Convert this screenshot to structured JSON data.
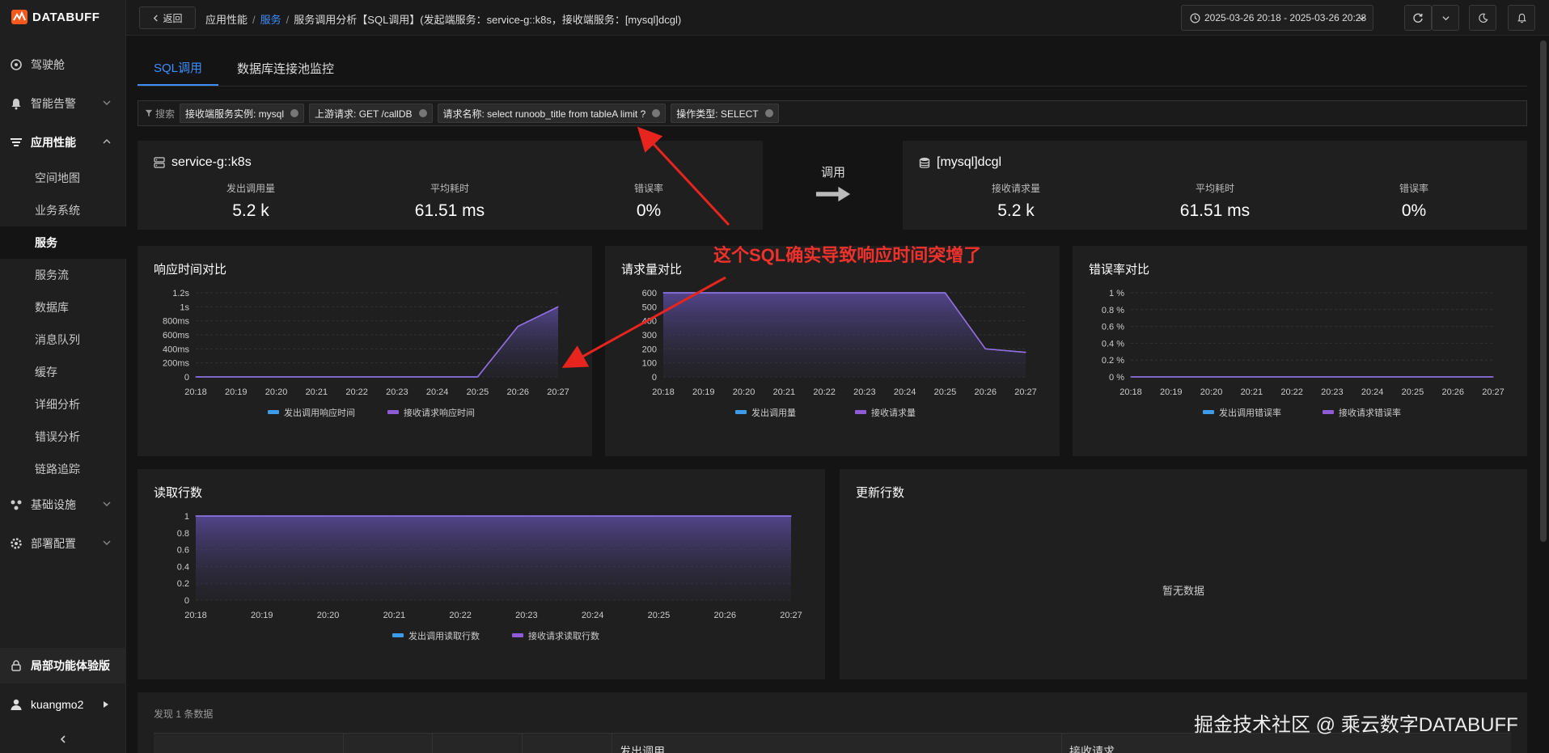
{
  "brand": {
    "name": "DATABUFF"
  },
  "sidebar": {
    "items": [
      {
        "label": "驾驶舱"
      },
      {
        "label": "智能告警"
      },
      {
        "label": "应用性能"
      },
      {
        "label": "基础设施"
      },
      {
        "label": "部署配置"
      }
    ],
    "sub_items": [
      {
        "label": "空间地图"
      },
      {
        "label": "业务系统"
      },
      {
        "label": "服务"
      },
      {
        "label": "服务流"
      },
      {
        "label": "数据库"
      },
      {
        "label": "消息队列"
      },
      {
        "label": "缓存"
      },
      {
        "label": "详细分析"
      },
      {
        "label": "错误分析"
      },
      {
        "label": "链路追踪"
      }
    ],
    "trial_label": "局部功能体验版",
    "user_name": "kuangmo2"
  },
  "topbar": {
    "back_label": "返回",
    "breadcrumb": {
      "root": "应用性能",
      "link": "服务",
      "current": "服务调用分析【SQL调用】(发起端服务：service-g::k8s，接收端服务：[mysql]dcgl)"
    },
    "time_range": "2025-03-26 20:18 - 2025-03-26 20:28"
  },
  "tabs": [
    {
      "label": "SQL调用"
    },
    {
      "label": "数据库连接池监控"
    }
  ],
  "filter": {
    "label": "搜索",
    "chips": [
      "接收端服务实例: mysql",
      "上游请求: GET /callDB",
      "请求名称: select runoob_title from tableA limit ?",
      "操作类型: SELECT"
    ]
  },
  "source": {
    "name": "service-g::k8s",
    "metrics": [
      {
        "label": "发出调用量",
        "value": "5.2 k"
      },
      {
        "label": "平均耗时",
        "value": "61.51 ms"
      },
      {
        "label": "错误率",
        "value": "0%"
      }
    ]
  },
  "call_label": "调用",
  "target": {
    "name": "[mysql]dcgl",
    "metrics": [
      {
        "label": "接收请求量",
        "value": "5.2 k"
      },
      {
        "label": "平均耗时",
        "value": "61.51 ms"
      },
      {
        "label": "错误率",
        "value": "0%"
      }
    ]
  },
  "annotation": "这个SQL确实导致响应时间突增了",
  "chart_data": [
    {
      "type": "area",
      "title": "响应时间对比",
      "x": [
        "20:18",
        "20:19",
        "20:20",
        "20:21",
        "20:22",
        "20:23",
        "20:24",
        "20:25",
        "20:26",
        "20:27"
      ],
      "yticks": [
        "0",
        "200ms",
        "400ms",
        "600ms",
        "800ms",
        "1s",
        "1.2s"
      ],
      "ylim": [
        0,
        1.2
      ],
      "series": [
        {
          "name": "发出调用响应时间",
          "color": "#3d9be9",
          "values": [
            0,
            0,
            0,
            0,
            0,
            0,
            0,
            0,
            0.72,
            1.0
          ]
        },
        {
          "name": "接收请求响应时间",
          "color": "#8f5bd6",
          "values": [
            0,
            0,
            0,
            0,
            0,
            0,
            0,
            0,
            0.72,
            1.0
          ]
        }
      ]
    },
    {
      "type": "area",
      "title": "请求量对比",
      "x": [
        "20:18",
        "20:19",
        "20:20",
        "20:21",
        "20:22",
        "20:23",
        "20:24",
        "20:25",
        "20:26",
        "20:27"
      ],
      "yticks": [
        "0",
        "100",
        "200",
        "300",
        "400",
        "500",
        "600"
      ],
      "ylim": [
        0,
        600
      ],
      "series": [
        {
          "name": "发出调用量",
          "color": "#3d9be9",
          "values": [
            600,
            600,
            600,
            600,
            600,
            600,
            600,
            600,
            200,
            175
          ]
        },
        {
          "name": "接收请求量",
          "color": "#8f5bd6",
          "values": [
            600,
            600,
            600,
            600,
            600,
            600,
            600,
            600,
            200,
            175
          ]
        }
      ]
    },
    {
      "type": "line",
      "title": "错误率对比",
      "x": [
        "20:18",
        "20:19",
        "20:20",
        "20:21",
        "20:22",
        "20:23",
        "20:24",
        "20:25",
        "20:26",
        "20:27"
      ],
      "yticks": [
        "0 %",
        "0.2 %",
        "0.4 %",
        "0.6 %",
        "0.8 %",
        "1 %"
      ],
      "ylim": [
        0,
        1
      ],
      "series": [
        {
          "name": "发出调用错误率",
          "color": "#3d9be9",
          "values": [
            0,
            0,
            0,
            0,
            0,
            0,
            0,
            0,
            0,
            0
          ]
        },
        {
          "name": "接收请求错误率",
          "color": "#8f5bd6",
          "values": [
            0,
            0,
            0,
            0,
            0,
            0,
            0,
            0,
            0,
            0
          ]
        }
      ]
    },
    {
      "type": "area",
      "title": "读取行数",
      "x": [
        "20:18",
        "20:19",
        "20:20",
        "20:21",
        "20:22",
        "20:23",
        "20:24",
        "20:25",
        "20:26",
        "20:27"
      ],
      "yticks": [
        "0",
        "0.2",
        "0.4",
        "0.6",
        "0.8",
        "1"
      ],
      "ylim": [
        0,
        1
      ],
      "series": [
        {
          "name": "发出调用读取行数",
          "color": "#3d9be9",
          "values": [
            1,
            1,
            1,
            1,
            1,
            1,
            1,
            1,
            1,
            1
          ]
        },
        {
          "name": "接收请求读取行数",
          "color": "#8f5bd6",
          "values": [
            1,
            1,
            1,
            1,
            1,
            1,
            1,
            1,
            1,
            1
          ]
        }
      ]
    }
  ],
  "update_rows": {
    "title": "更新行数",
    "empty": "暂无数据"
  },
  "table": {
    "found": "发现 1 条数据",
    "headers": [
      "发出调用",
      "接收请求"
    ]
  },
  "watermark": "掘金技术社区 @ 乘云数字DATABUFF"
}
